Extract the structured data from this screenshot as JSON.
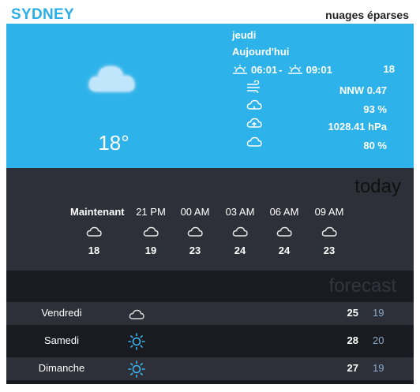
{
  "header": {
    "city": "SYDNEY",
    "condition": "nuages éparses"
  },
  "current": {
    "temperature": "18°",
    "day": "jeudi",
    "today_label": "Aujourd'hui",
    "sunrise": "06:01",
    "sunset": "09:01",
    "separator": "-",
    "high": "18",
    "wind": "NNW 0.47",
    "humidity": "93 %",
    "pressure": "1028.41 hPa",
    "cloudiness": "80 %",
    "icon": "cloud-icon"
  },
  "hourly": {
    "title": "today",
    "items": [
      {
        "label": "Maintenant",
        "temp": "18",
        "icon": "cloud-icon"
      },
      {
        "label": "21 PM",
        "temp": "19",
        "icon": "cloud-icon"
      },
      {
        "label": "00 AM",
        "temp": "23",
        "icon": "cloud-icon"
      },
      {
        "label": "03 AM",
        "temp": "24",
        "icon": "cloud-icon"
      },
      {
        "label": "06 AM",
        "temp": "24",
        "icon": "cloud-icon"
      },
      {
        "label": "09 AM",
        "temp": "23",
        "icon": "cloud-icon"
      }
    ]
  },
  "forecast": {
    "title": "forecast",
    "days": [
      {
        "day": "Vendredi",
        "high": "25",
        "low": "19",
        "icon": "cloud-icon"
      },
      {
        "day": "Samedi",
        "high": "28",
        "low": "20",
        "icon": "sun-icon"
      },
      {
        "day": "Dimanche",
        "high": "27",
        "low": "19",
        "icon": "sun-icon"
      }
    ]
  },
  "colors": {
    "accent": "#2db3ea",
    "panel": "#2d3038",
    "dark": "#1a1b20",
    "low_temp": "#8aa9c8"
  }
}
